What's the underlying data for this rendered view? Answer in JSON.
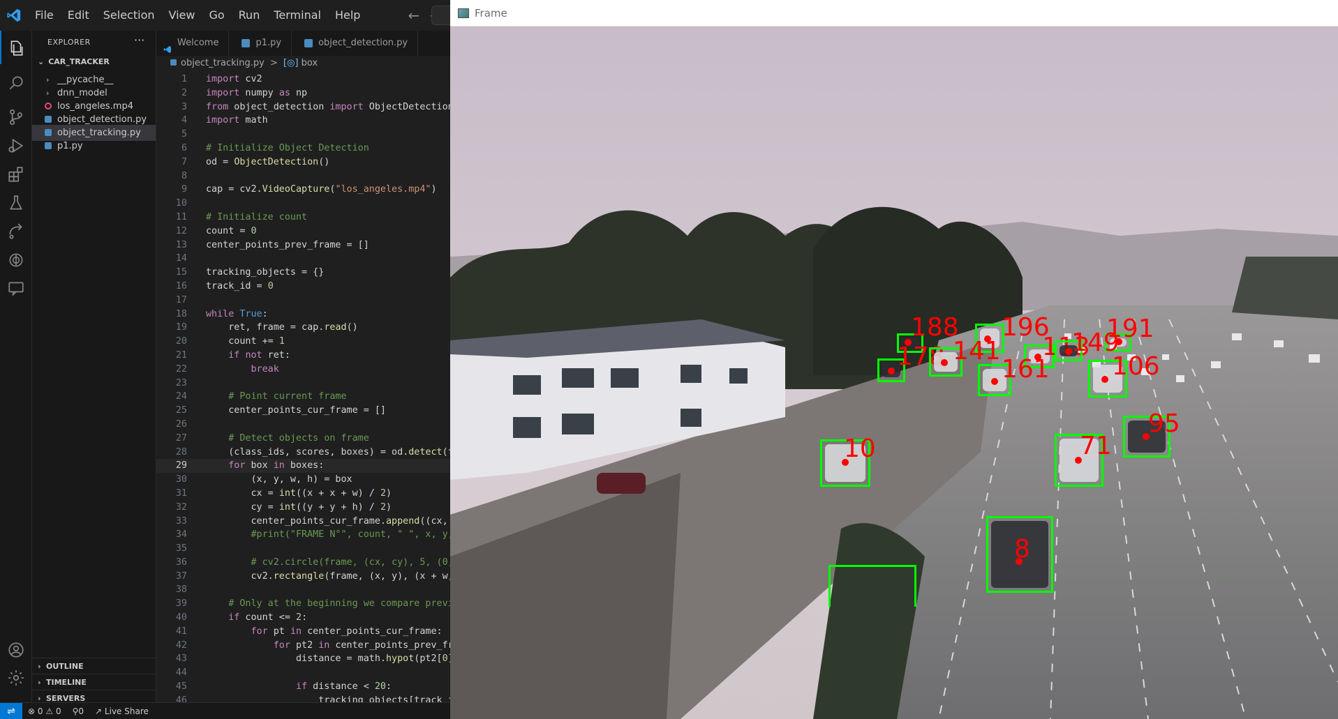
{
  "vscode": {
    "menu": [
      "File",
      "Edit",
      "Selection",
      "View",
      "Go",
      "Run",
      "Terminal",
      "Help"
    ],
    "explorer": {
      "title": "EXPLORER",
      "more": "···",
      "folder": "CAR_TRACKER",
      "items": [
        {
          "label": "__pycache__",
          "kind": "folder"
        },
        {
          "label": "dnn_model",
          "kind": "folder"
        },
        {
          "label": "los_angeles.mp4",
          "kind": "video"
        },
        {
          "label": "object_detection.py",
          "kind": "python"
        },
        {
          "label": "object_tracking.py",
          "kind": "python",
          "selected": true
        },
        {
          "label": "p1.py",
          "kind": "python"
        }
      ],
      "sections": [
        "OUTLINE",
        "TIMELINE",
        "SERVERS"
      ]
    },
    "tabs": [
      "Welcome",
      "p1.py",
      "object_detection.py"
    ],
    "breadcrumb": {
      "file": "object_tracking.py",
      "separator": ">",
      "symbol": "box"
    },
    "current_line": 29,
    "code": [
      "import cv2",
      "import numpy as np",
      "from object_detection import ObjectDetection",
      "import math",
      "",
      "# Initialize Object Detection",
      "od = ObjectDetection()",
      "",
      "cap = cv2.VideoCapture(\"los_angeles.mp4\")",
      "",
      "# Initialize count",
      "count = 0",
      "center_points_prev_frame = []",
      "",
      "tracking_objects = {}",
      "track_id = 0",
      "",
      "while True:",
      "    ret, frame = cap.read()",
      "    count += 1",
      "    if not ret:",
      "        break",
      "",
      "    # Point current frame",
      "    center_points_cur_frame = []",
      "",
      "    # Detect objects on frame",
      "    (class_ids, scores, boxes) = od.detect(f",
      "    for box in boxes:",
      "        (x, y, w, h) = box",
      "        cx = int((x + x + w) / 2)",
      "        cy = int((y + y + h) / 2)",
      "        center_points_cur_frame.append((cx,",
      "        #print(\"FRAME N°\", count, \" \", x, y,",
      "",
      "        # cv2.circle(frame, (cx, cy), 5, (0,",
      "        cv2.rectangle(frame, (x, y), (x + w,",
      "",
      "    # Only at the beginning we compare previ",
      "    if count <= 2:",
      "        for pt in center_points_cur_frame:",
      "            for pt2 in center_points_prev_fr",
      "                distance = math.hypot(pt2[0]",
      "",
      "                if distance < 20:",
      "                    tracking_objects[track_i"
    ],
    "status": {
      "errors": "0",
      "warnings": "0",
      "ports": "0",
      "live_share": "Live Share"
    },
    "colors": {
      "accent": "#0078d4",
      "background": "#1f1f1f"
    }
  },
  "frame_window": {
    "title": "Frame",
    "tracked_cars": [
      {
        "id": "188"
      },
      {
        "id": "196"
      },
      {
        "id": "191"
      },
      {
        "id": "178"
      },
      {
        "id": "141"
      },
      {
        "id": "113"
      },
      {
        "id": "149"
      },
      {
        "id": "161"
      },
      {
        "id": "106"
      },
      {
        "id": "95"
      },
      {
        "id": "10"
      },
      {
        "id": "71"
      },
      {
        "id": "8"
      }
    ],
    "colors": {
      "box": "#00ff00",
      "label": "#ff0000"
    }
  }
}
